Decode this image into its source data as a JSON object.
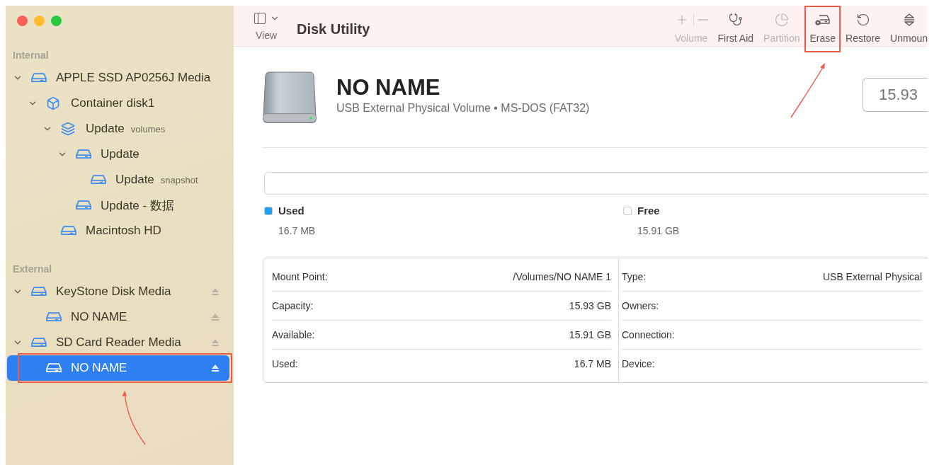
{
  "window": {
    "title": "Disk Utility"
  },
  "toolbar": {
    "view_label": "View",
    "items": [
      {
        "kind": "volume",
        "label": "Volume",
        "disabled": true,
        "highlighted": false
      },
      {
        "kind": "first_aid",
        "label": "First Aid",
        "disabled": false,
        "highlighted": false
      },
      {
        "kind": "partition",
        "label": "Partition",
        "disabled": true,
        "highlighted": false
      },
      {
        "kind": "erase",
        "label": "Erase",
        "disabled": false,
        "highlighted": true
      },
      {
        "kind": "restore",
        "label": "Restore",
        "disabled": false,
        "highlighted": false
      },
      {
        "kind": "unmount",
        "label": "Unmoun",
        "disabled": false,
        "highlighted": false
      }
    ]
  },
  "sidebar": {
    "sections": [
      {
        "heading": "Internal",
        "items": [
          {
            "kind": "drive",
            "name": "APPLE SSD AP0256J Media",
            "expanded": true,
            "eject": false,
            "selected": false,
            "highlighted": false,
            "children": [
              {
                "kind": "container",
                "name": "Container disk1",
                "expanded": true,
                "eject": false,
                "selected": false,
                "highlighted": false,
                "children": [
                  {
                    "kind": "volumes",
                    "name": "Update",
                    "suffix": "volumes",
                    "expanded": true,
                    "eject": false,
                    "selected": false,
                    "highlighted": false,
                    "children": [
                      {
                        "kind": "drive",
                        "name": "Update",
                        "expanded": true,
                        "eject": false,
                        "selected": false,
                        "highlighted": false,
                        "children": [
                          {
                            "kind": "drive",
                            "name": "Update",
                            "suffix": "snapshot",
                            "eject": false,
                            "selected": false,
                            "highlighted": false
                          }
                        ]
                      },
                      {
                        "kind": "drive",
                        "name": "Update - 数据",
                        "eject": false,
                        "selected": false,
                        "highlighted": false
                      }
                    ]
                  },
                  {
                    "kind": "drive",
                    "name": "Macintosh HD",
                    "eject": false,
                    "selected": false,
                    "highlighted": false
                  }
                ]
              }
            ]
          }
        ]
      },
      {
        "heading": "External",
        "items": [
          {
            "kind": "drive",
            "name": "KeyStone Disk Media",
            "expanded": true,
            "eject": true,
            "selected": false,
            "highlighted": false,
            "children": [
              {
                "kind": "drive",
                "name": "NO NAME",
                "eject": true,
                "selected": false,
                "highlighted": false
              }
            ]
          },
          {
            "kind": "drive",
            "name": "SD Card Reader Media",
            "expanded": true,
            "eject": true,
            "selected": false,
            "highlighted": false,
            "children": [
              {
                "kind": "drive",
                "name": "NO NAME",
                "eject": true,
                "selected": true,
                "highlighted": true
              }
            ]
          }
        ]
      }
    ]
  },
  "volume": {
    "name": "NO NAME",
    "subtitle": "USB External Physical Volume • MS-DOS (FAT32)",
    "capacity": "15.93",
    "legend": [
      {
        "label": "Used",
        "value": "16.7 MB",
        "color": "#1e9ff2"
      },
      {
        "label": "Free",
        "value": "15.91 GB",
        "color": "#ffffff"
      }
    ],
    "info_left": [
      {
        "label": "Mount Point:",
        "value": "/Volumes/NO NAME 1"
      },
      {
        "label": "Capacity:",
        "value": "15.93 GB"
      },
      {
        "label": "Available:",
        "value": "15.91 GB"
      },
      {
        "label": "Used:",
        "value": "16.7 MB"
      }
    ],
    "info_right": [
      {
        "label": "Type:",
        "value": "USB External Physical"
      },
      {
        "label": "Owners:"
      },
      {
        "label": "Connection:"
      },
      {
        "label": "Device:"
      }
    ]
  }
}
